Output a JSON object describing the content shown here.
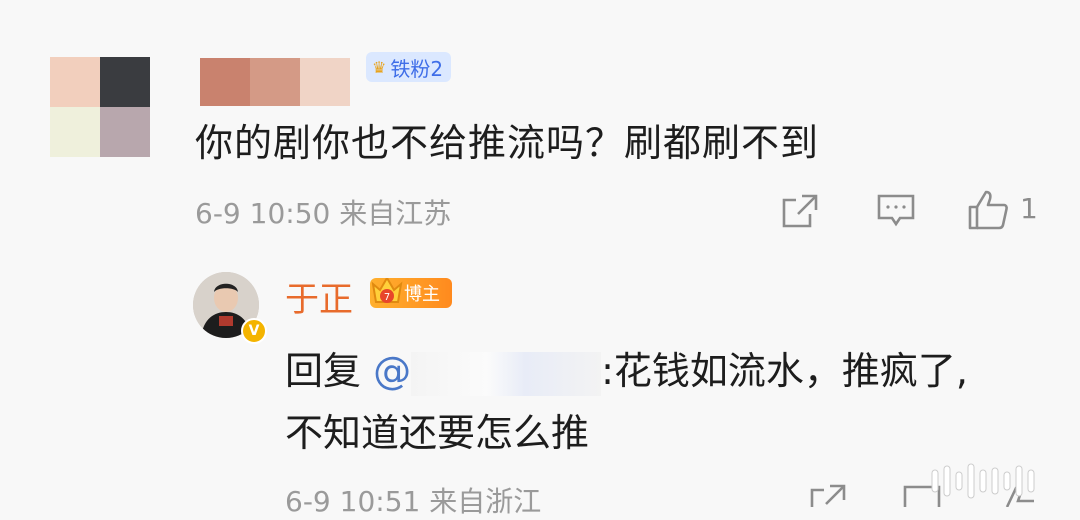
{
  "comment": {
    "fan_badge": "铁粉2",
    "text": "你的剧你也不给推流吗？刷都刷不到",
    "meta": "6-9 10:50  来自江苏",
    "like_count": "1"
  },
  "reply": {
    "author": "于正",
    "blogger_badge": "博主",
    "prefix": "回复",
    "at": "@",
    "text_line1": ":花钱如流水，推疯了,",
    "text_line2": "不知道还要怎么推",
    "meta": "6-9 10:51  来自浙江"
  },
  "icons": [
    "share-icon",
    "comment-icon",
    "like-icon"
  ],
  "colors": {
    "author_name": "#e86b2c",
    "fan_badge_bg": "#dbe8ff",
    "fan_badge_text": "#3f6ee8",
    "at_link": "#4a78c8",
    "meta": "#9a9a9a"
  }
}
